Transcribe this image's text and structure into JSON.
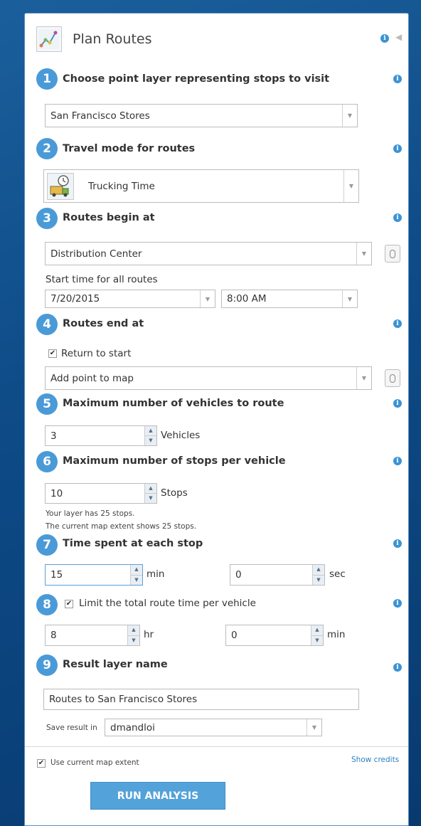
{
  "header": {
    "title": "Plan Routes",
    "info_icon": "info-icon",
    "collapse_icon": "caret-left-icon"
  },
  "steps": {
    "s1": {
      "num": "1",
      "label": "Choose point layer representing stops to visit",
      "select": "San Francisco Stores"
    },
    "s2": {
      "num": "2",
      "label": "Travel mode for routes",
      "select": "Trucking Time"
    },
    "s3": {
      "num": "3",
      "label": "Routes begin at",
      "select": "Distribution Center",
      "start_time_label": "Start time for all routes",
      "date": "7/20/2015",
      "time": "8:00 AM"
    },
    "s4": {
      "num": "4",
      "label": "Routes end at",
      "return_label": "Return to start",
      "select": "Add point to map"
    },
    "s5": {
      "num": "5",
      "label": "Maximum number of vehicles to route",
      "value": "3",
      "unit": "Vehicles"
    },
    "s6": {
      "num": "6",
      "label": "Maximum number of stops per vehicle",
      "value": "10",
      "unit": "Stops",
      "note1": "Your layer has 25 stops.",
      "note2": "The current map extent shows 25 stops."
    },
    "s7": {
      "num": "7",
      "label": "Time spent at each stop",
      "min_value": "15",
      "min_unit": "min",
      "sec_value": "0",
      "sec_unit": "sec"
    },
    "s8": {
      "num": "8",
      "label": "Limit the total route time per vehicle",
      "hr_value": "8",
      "hr_unit": "hr",
      "min_value": "0",
      "min_unit": "min"
    },
    "s9": {
      "num": "9",
      "label": "Result layer name",
      "value": "Routes to San Francisco Stores",
      "save_label": "Save result in",
      "save_folder": "dmandloi"
    }
  },
  "footer": {
    "extent_label": "Use current map extent",
    "credits": "Show credits",
    "run_button": "RUN ANALYSIS"
  },
  "colors": {
    "accent": "#4a9ad8",
    "button": "#53a2d9",
    "background": "#0d4a86"
  }
}
